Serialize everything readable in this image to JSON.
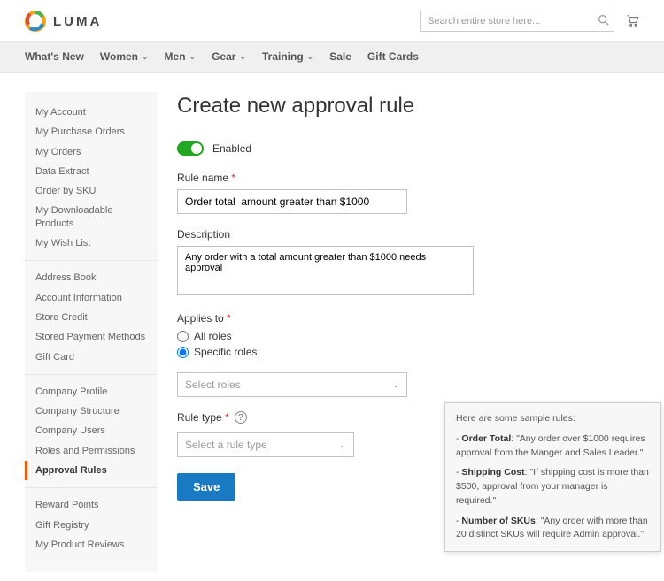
{
  "brand": "LUMA",
  "search": {
    "placeholder": "Search entire store here..."
  },
  "nav": [
    "What's New",
    "Women",
    "Men",
    "Gear",
    "Training",
    "Sale",
    "Gift Cards"
  ],
  "nav_has_caret": [
    false,
    true,
    true,
    true,
    true,
    false,
    false
  ],
  "sidebar": {
    "g1": [
      "My Account",
      "My Purchase Orders",
      "My Orders",
      "Data Extract",
      "Order by SKU",
      "My Downloadable Products",
      "My Wish List"
    ],
    "g2": [
      "Address Book",
      "Account Information",
      "Store Credit",
      "Stored Payment Methods",
      "Gift Card"
    ],
    "g3": [
      "Company Profile",
      "Company Structure",
      "Company Users",
      "Roles and Permissions",
      "Approval Rules"
    ],
    "g4": [
      "Reward Points",
      "Gift Registry",
      "My Product Reviews"
    ],
    "active": "Approval Rules"
  },
  "page": {
    "title": "Create new approval rule",
    "enabled_label": "Enabled",
    "rule_name_label": "Rule name",
    "rule_name_value": "Order total  amount greater than $1000",
    "desc_label": "Description",
    "desc_value": "Any order with a total amount greater than $1000 needs approval",
    "applies_label": "Applies to",
    "applies_all": "All roles",
    "applies_specific": "Specific roles",
    "select_roles_placeholder": "Select roles",
    "rule_type_label": "Rule type",
    "rule_type_placeholder": "Select a rule type",
    "save": "Save"
  },
  "tooltip": {
    "intro": "Here are some sample rules:",
    "r1_label": "Order Total",
    "r1_text": ": \"Any order over $1000 requires approval from the Manger and Sales Leader.\"",
    "r2_label": "Shipping Cost",
    "r2_text": ": \"If shipping cost is more than $500, approval from your manager is required.\"",
    "r3_label": "Number of SKUs",
    "r3_text": ": \"Any order with more than 20 distinct SKUs will require Admin approval.\""
  }
}
